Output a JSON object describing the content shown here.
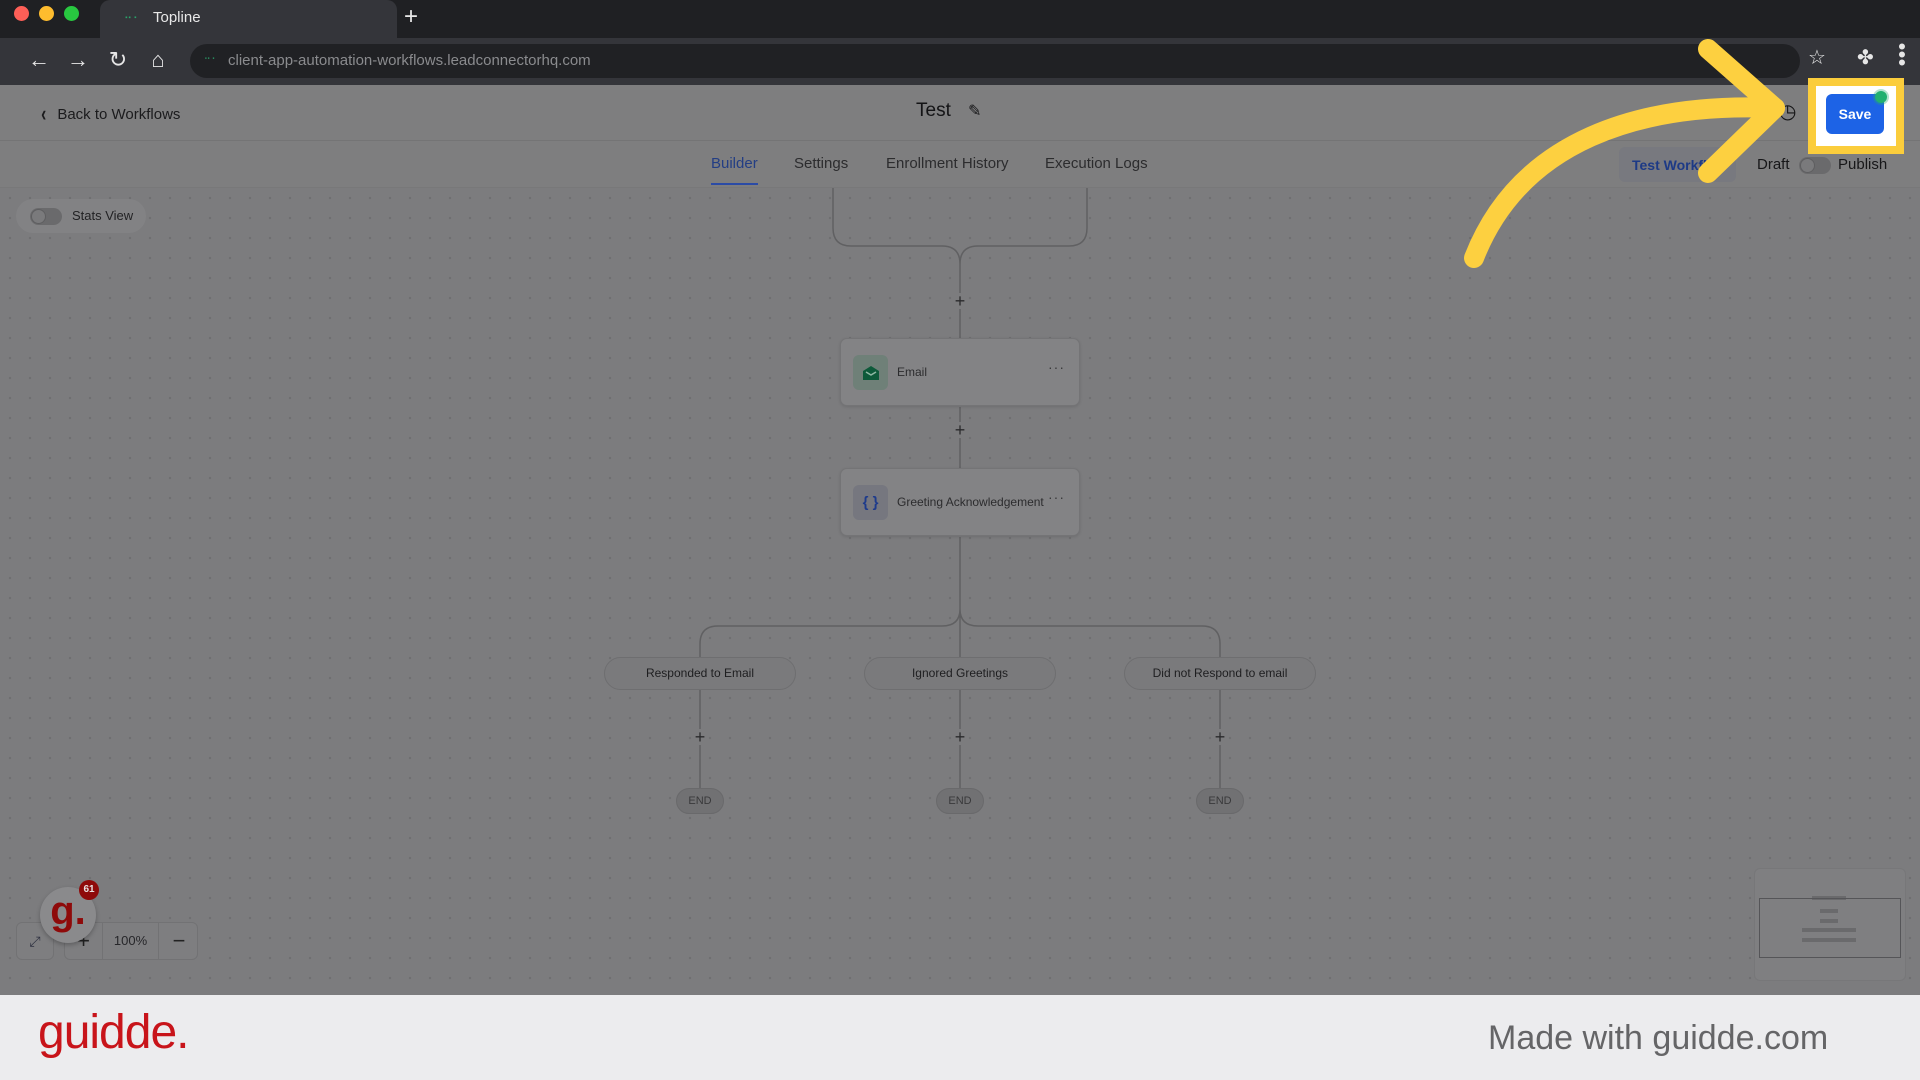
{
  "browser": {
    "tab_title": "Topline",
    "new_tab_label": "+",
    "url": "client-app-automation-workflows.leadconnectorhq.com",
    "icons": {
      "back": "arrow-left-icon",
      "forward": "arrow-right-icon",
      "reload": "reload-icon",
      "home": "home-icon",
      "bookmark": "star-icon",
      "extensions": "puzzle-icon",
      "menu": "kebab-menu-icon"
    },
    "glyphs": {
      "back": "←",
      "forward": "→",
      "reload": "↻",
      "home": "⌂",
      "star": "☆",
      "ext": "✤",
      "menu": "⋮",
      "fav": "⠒⠂"
    }
  },
  "header": {
    "back_label": "Back to Workflows",
    "back_glyph": "‹",
    "workflow_title": "Test",
    "edit_glyph": "✎",
    "history_glyph": "◷",
    "save_label": "Save"
  },
  "tabs": [
    {
      "label": "Builder",
      "active": true
    },
    {
      "label": "Settings",
      "active": false
    },
    {
      "label": "Enrollment History",
      "active": false
    },
    {
      "label": "Execution Logs",
      "active": false
    }
  ],
  "actions": {
    "test_workflow_label": "Test Workflow",
    "draft_label": "Draft",
    "publish_label": "Publish",
    "published": false
  },
  "canvas": {
    "stats_view_label": "Stats View",
    "stats_view_on": false,
    "add_glyph": "+",
    "nodes": [
      {
        "label": "Email",
        "icon": "envelope-open-icon",
        "glyph": "✉",
        "more": "···"
      },
      {
        "label": "Greeting Acknowledgement",
        "icon": "code-braces-icon",
        "glyph": "{ }",
        "more": "···"
      }
    ],
    "branches": [
      {
        "label": "Responded to Email",
        "end_label": "END"
      },
      {
        "label": "Ignored Greetings",
        "end_label": "END"
      },
      {
        "label": "Did not Respond to email",
        "end_label": "END"
      }
    ],
    "zoom": {
      "fit_glyph": "⤢",
      "zoom_in": "+",
      "level": "100%",
      "zoom_out": "−"
    }
  },
  "guidde_widget": {
    "glyph": "g.",
    "count": "61"
  },
  "colors": {
    "save_button": "#1d63e6",
    "highlight": "#fbcd3c",
    "active_tab": "#233e84",
    "brand_red": "#c8141a",
    "status_green": "#22b070"
  },
  "footer": {
    "logo": "guidde.",
    "tagline": "Made with guidde.com"
  }
}
